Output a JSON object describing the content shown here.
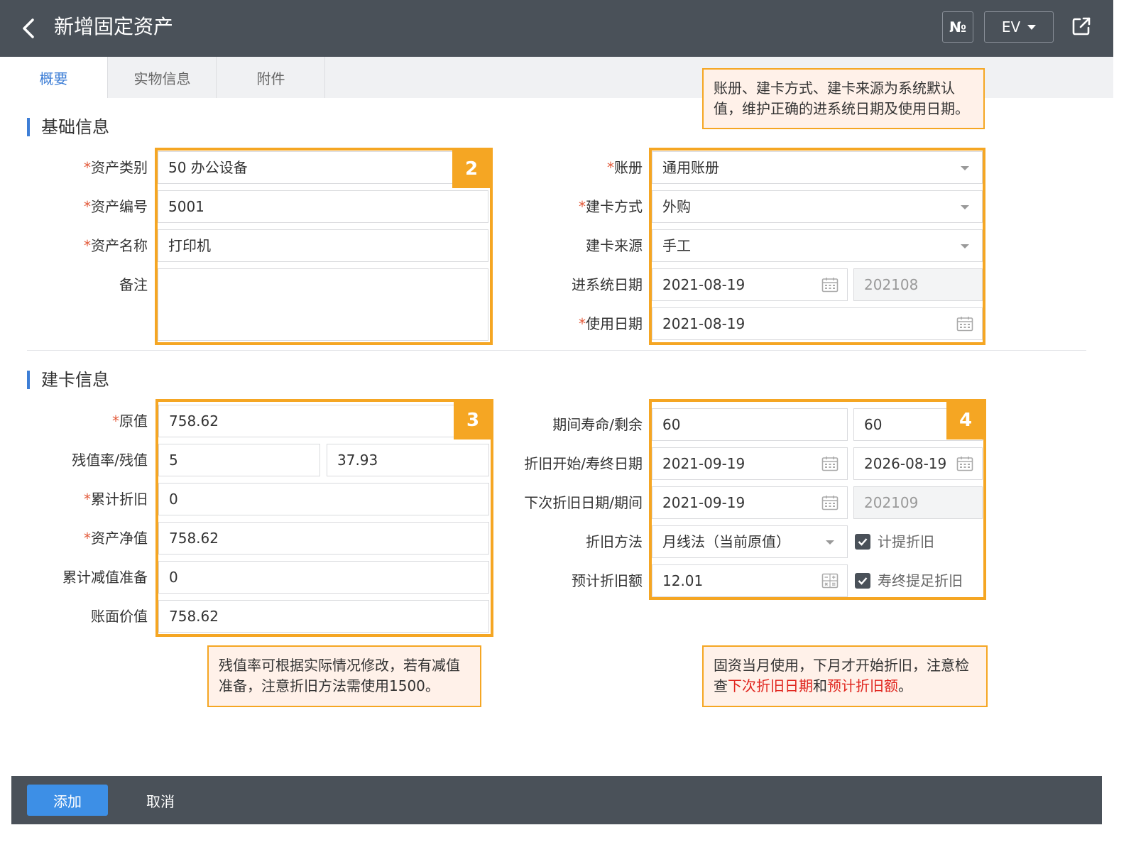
{
  "header": {
    "title": "新增固定资产",
    "num_label": "№",
    "lang_label": "EV"
  },
  "tabs": [
    {
      "label": "概要",
      "active": true
    },
    {
      "label": "实物信息",
      "active": false
    },
    {
      "label": "附件",
      "active": false
    }
  ],
  "sections": {
    "basic": "基础信息",
    "card": "建卡信息"
  },
  "required_mark": "*",
  "basic_left": {
    "category_label": "资产类别",
    "category_value": "50 办公设备",
    "code_label": "资产编号",
    "code_value": "5001",
    "name_label": "资产名称",
    "name_value": "打印机",
    "remark_label": "备注",
    "remark_value": ""
  },
  "basic_right": {
    "book_label": "账册",
    "book_value": "通用账册",
    "method_label": "建卡方式",
    "method_value": "外购",
    "source_label": "建卡来源",
    "source_value": "手工",
    "entry_date_label": "进系统日期",
    "entry_date_value": "2021-08-19",
    "entry_period_value": "202108",
    "use_date_label": "使用日期",
    "use_date_value": "2021-08-19"
  },
  "card_left": {
    "original_label": "原值",
    "original_value": "758.62",
    "residual_label": "残值率/残值",
    "residual_rate_value": "5",
    "residual_value": "37.93",
    "accum_dep_label": "累计折旧",
    "accum_dep_value": "0",
    "net_label": "资产净值",
    "net_value": "758.62",
    "impair_label": "累计减值准备",
    "impair_value": "0",
    "book_value_label": "账面价值",
    "book_value_value": "758.62"
  },
  "card_right": {
    "life_label": "期间寿命/剩余",
    "life_value": "60",
    "life_remaining_value": "60",
    "dep_start_label": "折旧开始/寿终日期",
    "dep_start_value": "2021-09-19",
    "dep_end_value": "2026-08-19",
    "next_dep_label": "下次折旧日期/期间",
    "next_dep_value": "2021-09-19",
    "next_period_value": "202109",
    "dep_method_label": "折旧方法",
    "dep_method_value": "月线法（当前原值）",
    "accrue_label": "计提折旧",
    "accrue_checked": true,
    "est_dep_label": "预计折旧额",
    "est_dep_value": "12.01",
    "full_dep_label": "寿终提足折旧",
    "full_dep_checked": true
  },
  "badges": {
    "b2": "2",
    "b3": "3",
    "b4": "4"
  },
  "notes": {
    "top": "账册、建卡方式、建卡来源为系统默认值，维护正确的进系统日期及使用日期。",
    "left": "残值率可根据实际情况修改，若有减值准备，注意折旧方法需使用1500。",
    "right_part1": "固资当月使用，下月才开始折旧，注意检查",
    "right_red1": "下次折旧日期",
    "right_mid": "和",
    "right_red2": "预计折旧额",
    "right_end": "。"
  },
  "footer": {
    "add_label": "添加",
    "cancel_label": "取消"
  },
  "colors": {
    "topbar": "#4a5159",
    "accent": "#3d7ed6",
    "highlight": "#f5a623",
    "note_bg": "#fff1e9",
    "note_red": "#e0261f",
    "button": "#3d8fe6"
  }
}
